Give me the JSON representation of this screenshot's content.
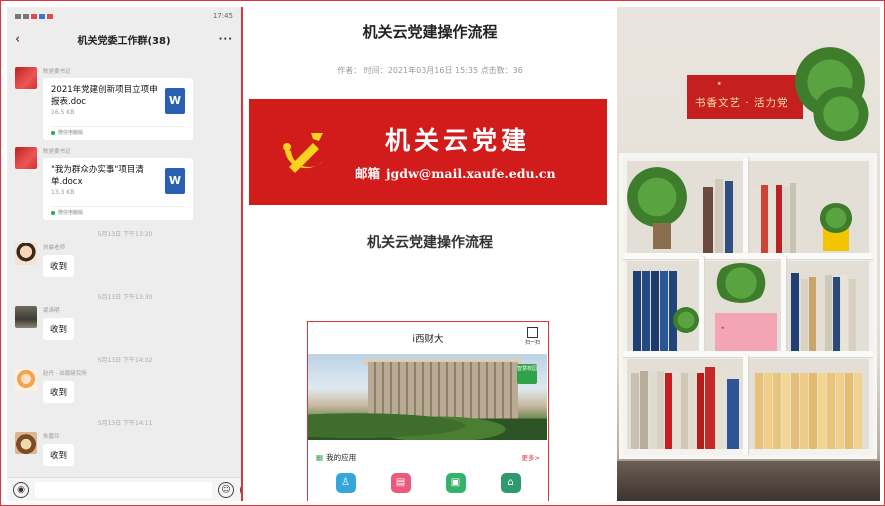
{
  "chat": {
    "status_time": "17:45",
    "title": "机关党委工作群(38)",
    "back_icon": "chevron-left-icon",
    "more_icon": "more-dots-icon",
    "messages": [
      {
        "sender": "陈党委书记",
        "file_name": "2021年党建创新项目立项申报表.doc",
        "file_size": "16.5 KB",
        "source": "微信电脑版",
        "file_icon": "W"
      },
      {
        "sender": "陈党委书记",
        "file_name": "\"我为群众办实事\"项目清单.docx",
        "file_size": "13.3 KB",
        "source": "微信电脑版",
        "file_icon": "W"
      }
    ],
    "replies": [
      {
        "time": "5月13日 下午13:20",
        "sender": "刘晨老师",
        "text": "收到"
      },
      {
        "time": "5月13日 下午13:30",
        "sender": "梁涛明",
        "text": "收到"
      },
      {
        "time": "5月13日 下午14:02",
        "sender": "赵丹 · 出版研究所",
        "text": "收到"
      },
      {
        "time": "5月13日 下午14:11",
        "sender": "朱嘉玲",
        "text": "收到"
      }
    ],
    "input_placeholder": ""
  },
  "article": {
    "title": "机关云党建操作流程",
    "meta": "作者： 时间：2021年03月16日 15:35 点击数：36",
    "banner_title": "机关云党建",
    "banner_mail_label": "邮箱",
    "banner_mail": "jgdw@mail.xaufe.edu.cn",
    "subtitle": "机关云党建操作流程",
    "app": {
      "title": "i西财大",
      "scan_label": "扫一扫",
      "badge": "智慧校园",
      "section": "我的应用",
      "more": "更多>"
    }
  },
  "photo": {
    "slogan": "书香文艺 · 活力党"
  }
}
